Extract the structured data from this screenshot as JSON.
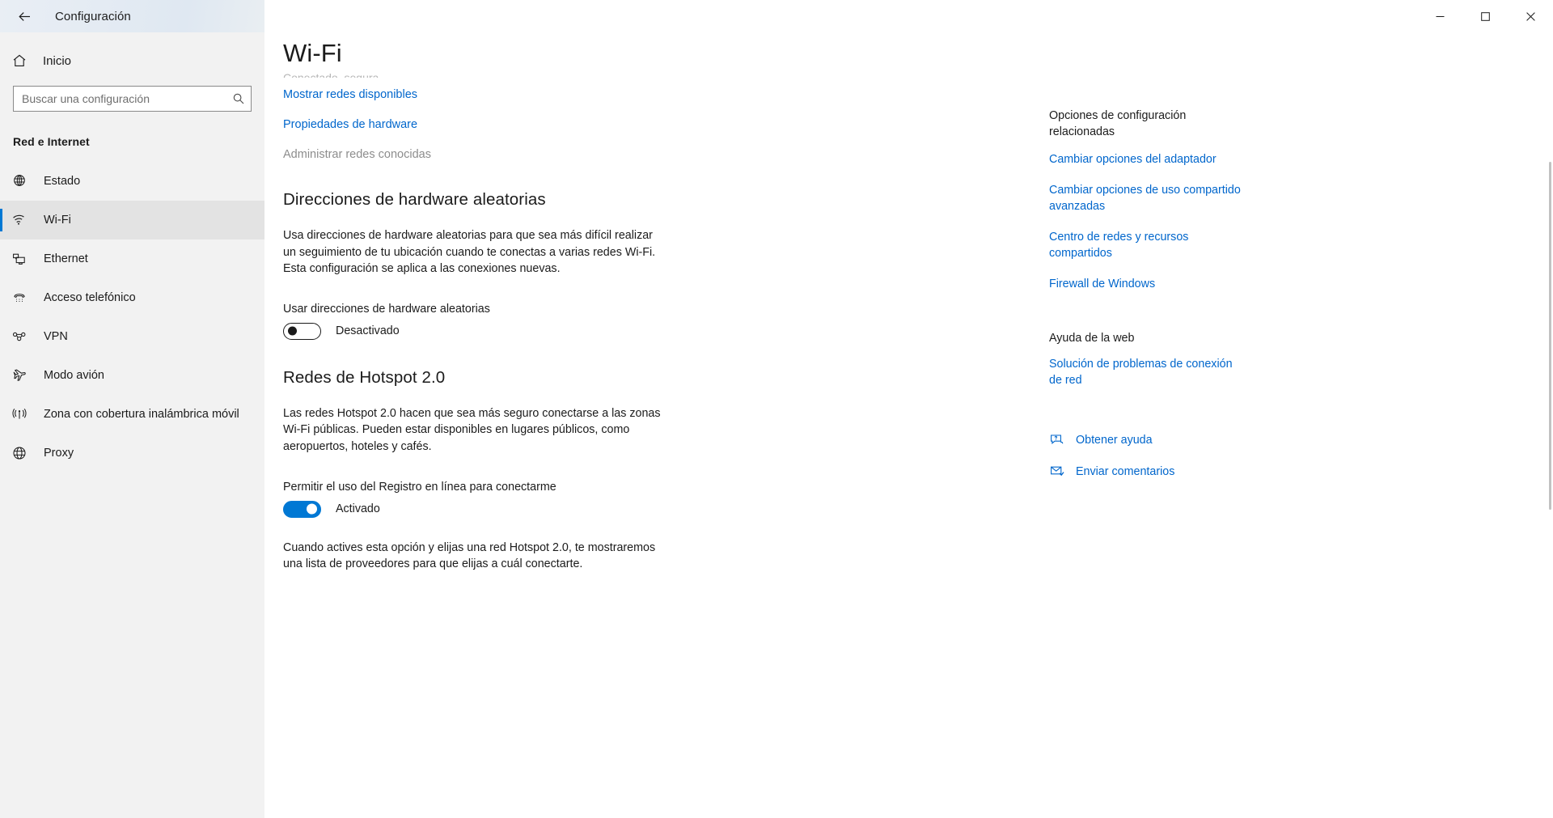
{
  "window": {
    "title": "Configuración",
    "back_icon": "back-arrow-icon",
    "minimize_icon": "minimize-icon",
    "maximize_icon": "maximize-icon",
    "close_icon": "close-icon"
  },
  "sidebar": {
    "home_label": "Inicio",
    "home_icon": "home-icon",
    "search": {
      "placeholder": "Buscar una configuración",
      "value": "",
      "icon": "search-icon"
    },
    "section_title": "Red e Internet",
    "items": [
      {
        "label": "Estado",
        "icon": "globe-status-icon",
        "selected": false
      },
      {
        "label": "Wi-Fi",
        "icon": "wifi-icon",
        "selected": true
      },
      {
        "label": "Ethernet",
        "icon": "ethernet-icon",
        "selected": false
      },
      {
        "label": "Acceso telefónico",
        "icon": "dialup-phone-icon",
        "selected": false
      },
      {
        "label": "VPN",
        "icon": "vpn-icon",
        "selected": false
      },
      {
        "label": "Modo avión",
        "icon": "airplane-icon",
        "selected": false
      },
      {
        "label": "Zona con cobertura inalámbrica móvil",
        "icon": "mobile-hotspot-icon",
        "selected": false
      },
      {
        "label": "Proxy",
        "icon": "proxy-globe-icon",
        "selected": false
      }
    ]
  },
  "main": {
    "page_title": "Wi-Fi",
    "clipped_status": "Conectado, segura",
    "links": [
      {
        "label": "Mostrar redes disponibles",
        "disabled": false
      },
      {
        "label": "Propiedades de hardware",
        "disabled": false
      },
      {
        "label": "Administrar redes conocidas",
        "disabled": true
      }
    ],
    "random_hw": {
      "heading": "Direcciones de hardware aleatorias",
      "description": "Usa direcciones de hardware aleatorias para que sea más difícil realizar un seguimiento de tu ubicación cuando te conectas a varias redes Wi-Fi. Esta configuración se aplica a las conexiones nuevas.",
      "toggle_label": "Usar direcciones de hardware aleatorias",
      "toggle_state": "Desactivado",
      "toggle_on": false
    },
    "hotspot": {
      "heading": "Redes de Hotspot 2.0",
      "description": "Las redes Hotspot 2.0 hacen que sea más seguro conectarse a las zonas Wi-Fi públicas. Pueden estar disponibles en lugares públicos, como aeropuertos, hoteles y cafés.",
      "toggle_label": "Permitir el uso del Registro en línea para conectarme",
      "toggle_state": "Activado",
      "toggle_on": true,
      "note": "Cuando actives esta opción y elijas una red Hotspot 2.0, te mostraremos una lista de proveedores para que elijas a cuál conectarte."
    }
  },
  "rail": {
    "related_heading": "Opciones de configuración relacionadas",
    "related_links": [
      "Cambiar opciones del adaptador",
      "Cambiar opciones de uso compartido avanzadas",
      "Centro de redes y recursos compartidos",
      "Firewall de Windows"
    ],
    "web_help_heading": "Ayuda de la web",
    "web_help_links": [
      "Solución de problemas de conexión de red"
    ],
    "support": [
      {
        "label": "Obtener ayuda",
        "icon": "get-help-icon"
      },
      {
        "label": "Enviar comentarios",
        "icon": "send-feedback-icon"
      }
    ]
  },
  "colors": {
    "accent": "#0078d4",
    "link": "#0066cc",
    "sidebar_bg": "#f2f2f2",
    "text": "#1b1b1b",
    "disabled_text": "#8d8d8d"
  }
}
